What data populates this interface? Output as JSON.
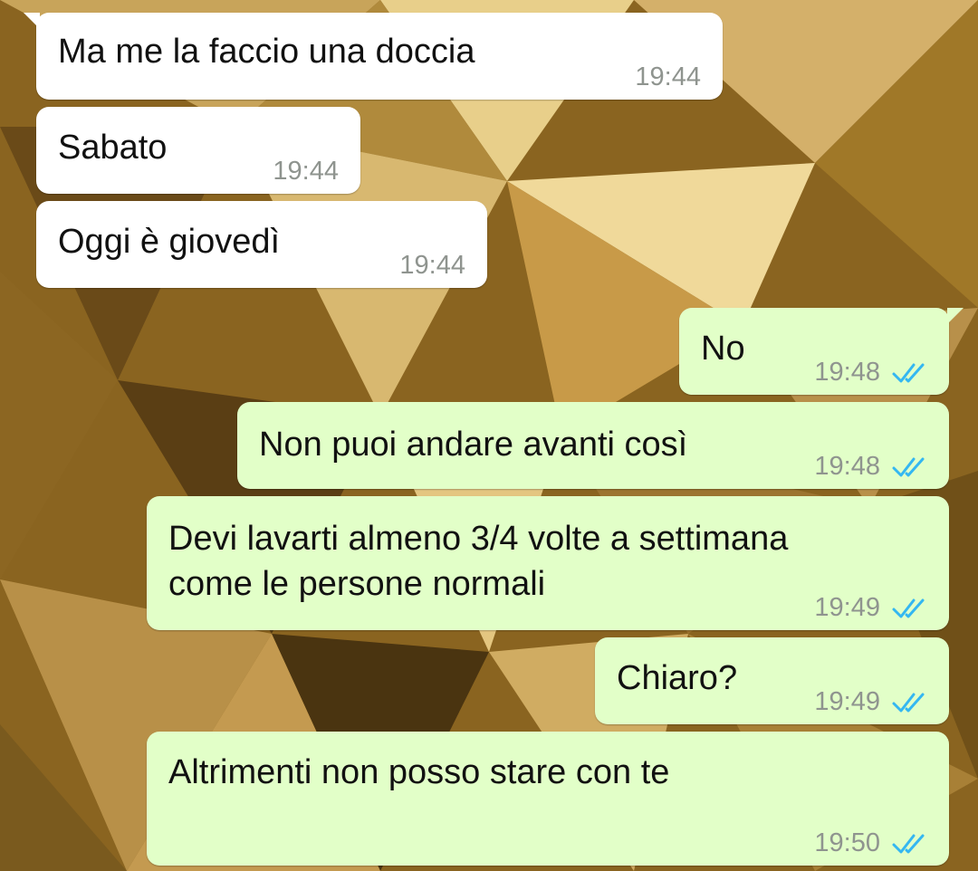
{
  "chat": {
    "messages": [
      {
        "direction": "in",
        "text": "Ma me la faccio una doccia",
        "time": "19:44"
      },
      {
        "direction": "in",
        "text": "Sabato",
        "time": "19:44"
      },
      {
        "direction": "in",
        "text": "Oggi è giovedì",
        "time": "19:44"
      },
      {
        "direction": "out",
        "text": "No",
        "time": "19:48",
        "status": "read"
      },
      {
        "direction": "out",
        "text": "Non puoi andare avanti così",
        "time": "19:48",
        "status": "read"
      },
      {
        "direction": "out",
        "text": "Devi lavarti almeno 3/4 volte a settimana\ncome le persone normali",
        "time": "19:49",
        "status": "read"
      },
      {
        "direction": "out",
        "text": "Chiaro?",
        "time": "19:49",
        "status": "read"
      },
      {
        "direction": "out",
        "text": "Altrimenti non posso stare con te",
        "time": "19:50",
        "status": "read"
      }
    ]
  },
  "colors": {
    "incoming_bubble": "#ffffff",
    "outgoing_bubble": "#e2ffc8",
    "read_ticks": "#34b7f1",
    "timestamp": "#8f948f",
    "wallpaper": "#8a6420"
  }
}
